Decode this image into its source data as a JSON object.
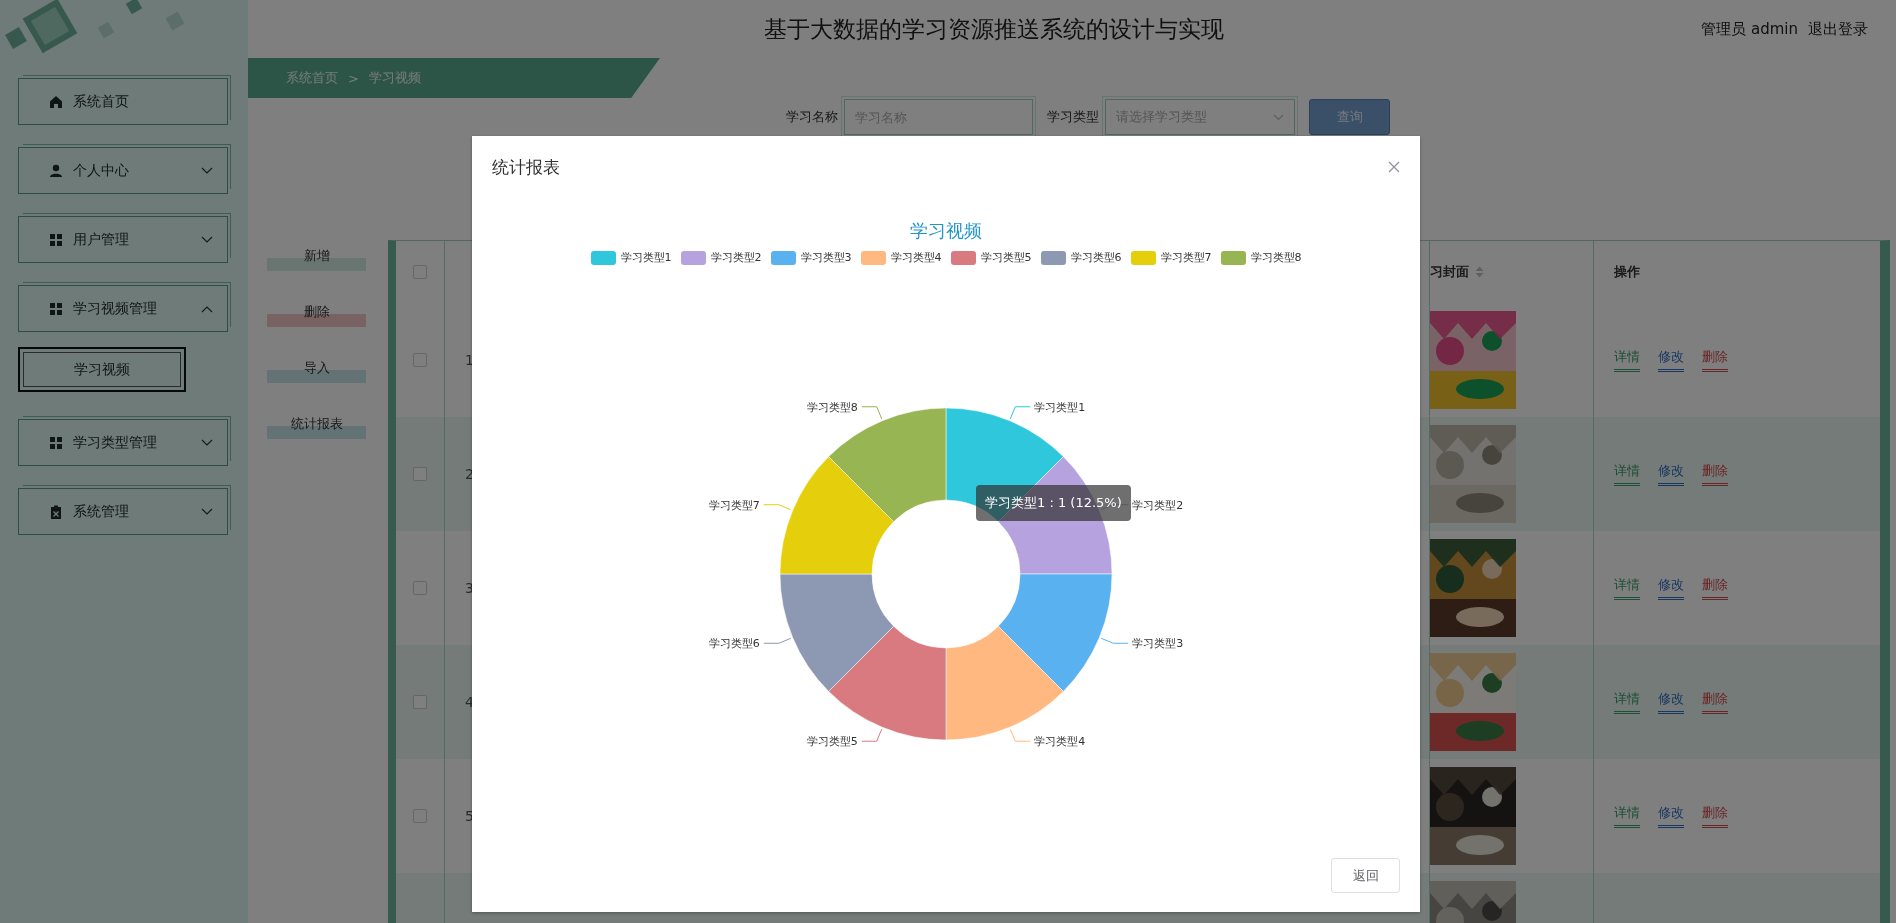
{
  "header": {
    "title": "基于大数据的学习资源推送系统的设计与实现",
    "user": "管理员 admin",
    "logout": "退出登录"
  },
  "sidebar": {
    "items": [
      {
        "label": "系统首页",
        "kind": "link"
      },
      {
        "label": "个人中心",
        "kind": "menu",
        "expanded": false
      },
      {
        "label": "用户管理",
        "kind": "menu",
        "expanded": false
      },
      {
        "label": "学习视频管理",
        "kind": "menu",
        "expanded": true,
        "children": [
          {
            "label": "学习视频",
            "selected": true
          }
        ]
      },
      {
        "label": "学习类型管理",
        "kind": "menu",
        "expanded": false
      },
      {
        "label": "系统管理",
        "kind": "menu",
        "expanded": false
      }
    ]
  },
  "breadcrumb": {
    "items": [
      "系统首页",
      "学习视频"
    ],
    "separator": ">"
  },
  "search": {
    "fields": [
      {
        "label": "学习名称",
        "placeholder": "学习名称",
        "kind": "input"
      },
      {
        "label": "学习类型",
        "placeholder": "请选择学习类型",
        "kind": "select"
      }
    ],
    "button": "查询"
  },
  "actions": [
    {
      "label": "新增",
      "color": "#687570"
    },
    {
      "label": "删除",
      "color": "#796262"
    },
    {
      "label": "导入",
      "color": "#637274"
    },
    {
      "label": "统计报表",
      "color": "#637274"
    }
  ],
  "table": {
    "header_checked": false,
    "columns": [
      {
        "label": "习封面",
        "sortable": true
      },
      {
        "label": "操作",
        "sortable": false
      }
    ],
    "rows": [
      {
        "checked": false,
        "index": "1",
        "cover": {
          "kind": "picture"
        },
        "actions": [
          {
            "label": "详情",
            "kind": "view"
          },
          {
            "label": "修改",
            "kind": "edit"
          },
          {
            "label": "删除",
            "kind": "delete"
          }
        ]
      },
      {
        "checked": false,
        "index": "2",
        "cover": {
          "kind": "picture"
        },
        "actions": [
          {
            "label": "详情",
            "kind": "view"
          },
          {
            "label": "修改",
            "kind": "edit"
          },
          {
            "label": "删除",
            "kind": "delete"
          }
        ]
      },
      {
        "checked": false,
        "index": "3",
        "cover": {
          "kind": "picture"
        },
        "actions": [
          {
            "label": "详情",
            "kind": "view"
          },
          {
            "label": "修改",
            "kind": "edit"
          },
          {
            "label": "删除",
            "kind": "delete"
          }
        ]
      },
      {
        "checked": false,
        "index": "4",
        "cover": {
          "kind": "picture"
        },
        "actions": [
          {
            "label": "详情",
            "kind": "view"
          },
          {
            "label": "修改",
            "kind": "edit"
          },
          {
            "label": "删除",
            "kind": "delete"
          }
        ]
      },
      {
        "checked": false,
        "index": "5",
        "cover": {
          "kind": "picture"
        },
        "actions": [
          {
            "label": "详情",
            "kind": "view"
          },
          {
            "label": "修改",
            "kind": "edit"
          },
          {
            "label": "删除",
            "kind": "delete"
          }
        ]
      },
      {
        "cover": {
          "kind": "picture"
        }
      }
    ]
  },
  "modal": {
    "title": "统计报表",
    "button": "返回",
    "legend": [
      {
        "label": "学习类型1",
        "color": "#2ec7dc"
      },
      {
        "label": "学习类型2",
        "color": "#b6a2de"
      },
      {
        "label": "学习类型3",
        "color": "#5ab1ef"
      },
      {
        "label": "学习类型4",
        "color": "#ffb980"
      },
      {
        "label": "学习类型5",
        "color": "#d87a80"
      },
      {
        "label": "学习类型6",
        "color": "#8d98b3"
      },
      {
        "label": "学习类型7",
        "color": "#e5cf0d"
      },
      {
        "label": "学习类型8",
        "color": "#97b552"
      }
    ],
    "chart_data": {
      "type": "donut",
      "title": "学习视频",
      "categories": [
        "学习类型1",
        "学习类型2",
        "学习类型3",
        "学习类型4",
        "学习类型5",
        "学习类型6",
        "学习类型7",
        "学习类型8"
      ],
      "values": [
        1,
        1,
        1,
        1,
        1,
        1,
        1,
        1
      ]
    },
    "tooltip": "学习类型1 : 1 (12.5%)"
  }
}
